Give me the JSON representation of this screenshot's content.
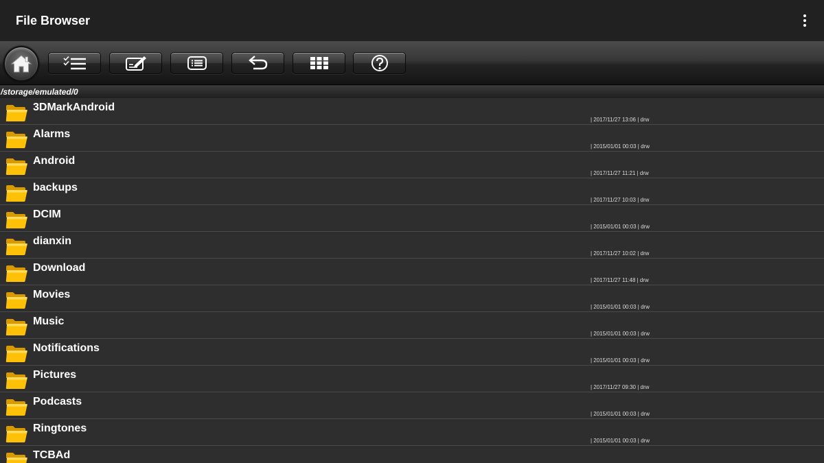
{
  "app": {
    "title": "File Browser"
  },
  "toolbar": {
    "buttons": [
      {
        "icon": "home-icon"
      },
      {
        "icon": "checklist-icon"
      },
      {
        "icon": "edit-icon"
      },
      {
        "icon": "list-icon"
      },
      {
        "icon": "undo-icon"
      },
      {
        "icon": "grid-icon"
      },
      {
        "icon": "help-icon"
      }
    ]
  },
  "path": "/storage/emulated/0",
  "colors": {
    "folder": "#ffc107",
    "background": "#2e2e2e",
    "appbar": "#212121"
  },
  "files": [
    {
      "name": "3DMarkAndroid",
      "meta": "| 2017/11/27 13:06 | drw"
    },
    {
      "name": "Alarms",
      "meta": "| 2015/01/01 00:03 | drw"
    },
    {
      "name": "Android",
      "meta": "| 2017/11/27 11:21 | drw"
    },
    {
      "name": "backups",
      "meta": "| 2017/11/27 10:03 | drw"
    },
    {
      "name": "DCIM",
      "meta": "| 2015/01/01 00:03 | drw"
    },
    {
      "name": "dianxin",
      "meta": "| 2017/11/27 10:02 | drw"
    },
    {
      "name": "Download",
      "meta": "| 2017/11/27 11:48 | drw"
    },
    {
      "name": "Movies",
      "meta": "| 2015/01/01 00:03 | drw"
    },
    {
      "name": "Music",
      "meta": "| 2015/01/01 00:03 | drw"
    },
    {
      "name": "Notifications",
      "meta": "| 2015/01/01 00:03 | drw"
    },
    {
      "name": "Pictures",
      "meta": "| 2017/11/27 09:30 | drw"
    },
    {
      "name": "Podcasts",
      "meta": "| 2015/01/01 00:03 | drw"
    },
    {
      "name": "Ringtones",
      "meta": "| 2015/01/01 00:03 | drw"
    },
    {
      "name": "TCBAd",
      "meta": ""
    }
  ]
}
